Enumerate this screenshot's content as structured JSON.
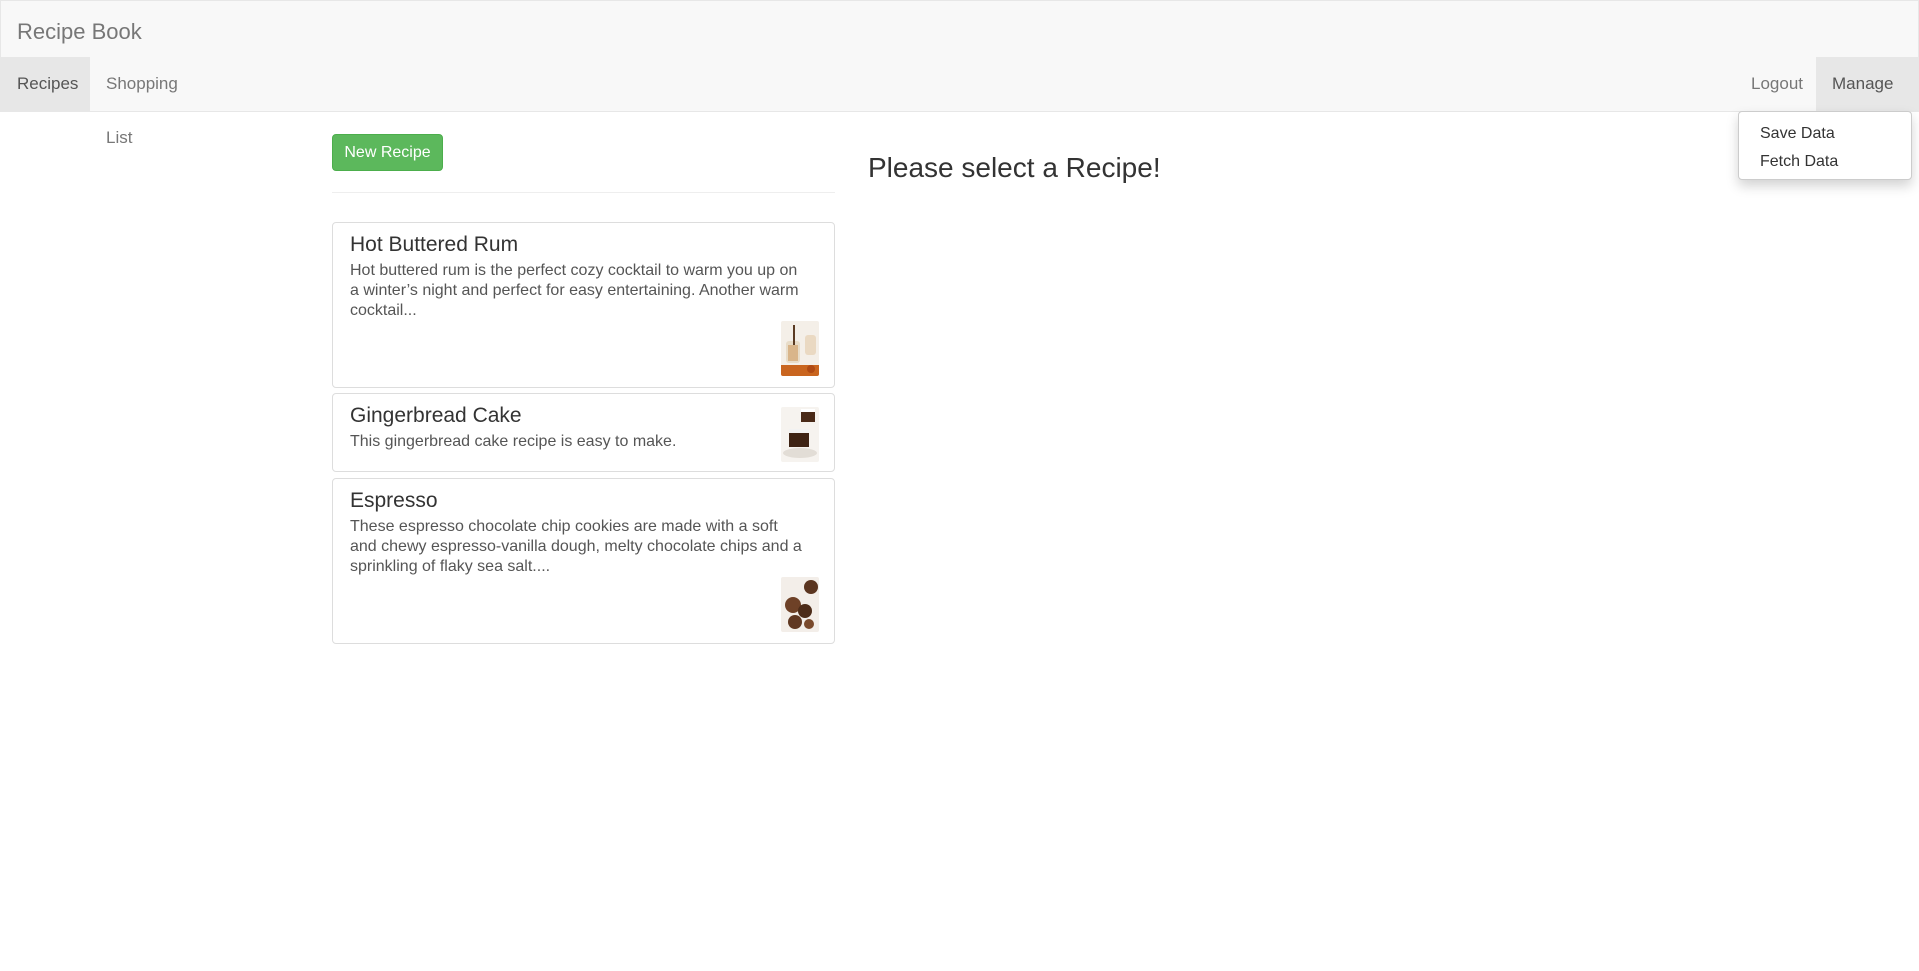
{
  "app": {
    "brand": "Recipe Book"
  },
  "nav": {
    "recipes": "Recipes",
    "shopping_list": "Shopping List",
    "logout": "Logout",
    "manage": "Manage"
  },
  "manage_menu": [
    "Save Data",
    "Fetch Data"
  ],
  "new_recipe_button": "New Recipe",
  "recipes": [
    {
      "name": "Hot Buttered Rum",
      "description": "Hot buttered rum is the perfect cozy cocktail to warm you up on a winter’s night and perfect for easy entertaining. Another warm cocktail...",
      "image": "hot-buttered-rum-photo"
    },
    {
      "name": "Gingerbread Cake",
      "description": "This gingerbread cake recipe is easy to make.",
      "image": "gingerbread-cake-photo"
    },
    {
      "name": "Espresso",
      "description": "These espresso chocolate chip cookies are made with a soft and chewy espresso-vanilla dough, melty chocolate chips and a sprinkling of flaky sea salt....",
      "image": "espresso-cookies-photo"
    }
  ],
  "detail_placeholder": "Please select a Recipe!",
  "colors": {
    "success": "#5cb85c",
    "navbar_bg": "#f8f8f8",
    "active_tab": "#e7e7e7"
  }
}
